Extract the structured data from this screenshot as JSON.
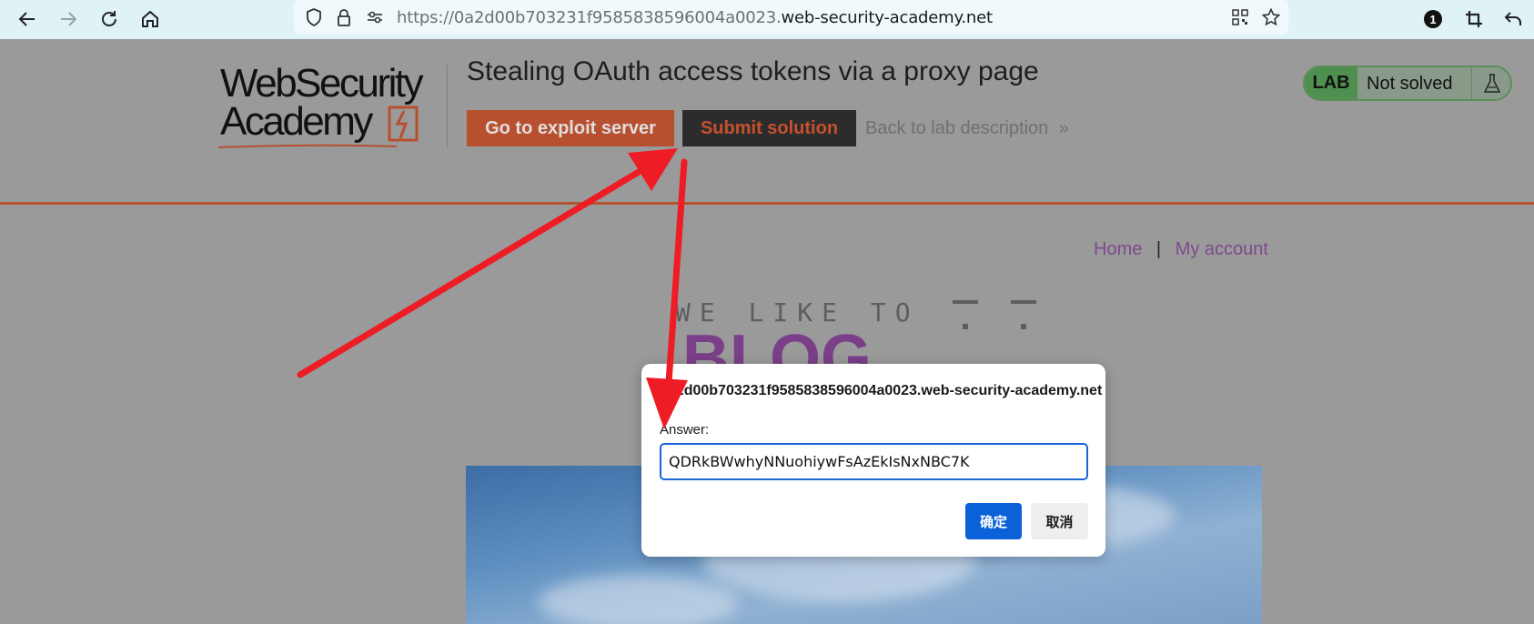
{
  "browser": {
    "url_prefix": "https://0a2d00b703231f9585838596004a0023.",
    "url_domain": "web-security-academy.net",
    "extension_badge": "1"
  },
  "header": {
    "logo_line1": "WebSecurity",
    "logo_line2": "Academy",
    "lab_title": "Stealing OAuth access tokens via a proxy page",
    "exploit_button": "Go to exploit server",
    "submit_button": "Submit solution",
    "back_link": "Back to lab description",
    "back_link_glyph": "»",
    "lab_badge": "LAB",
    "lab_status": "Not solved"
  },
  "nav": {
    "home": "Home",
    "separator": "|",
    "my_account": "My account"
  },
  "blog": {
    "tagline": "WE LIKE TO",
    "big_word": "BLOG"
  },
  "dialog": {
    "origin": "0a2d00b703231f9585838596004a0023.web-security-academy.net",
    "answer_label": "Answer:",
    "answer_value": "QDRkBWwhyNNuohiywFsAzEkIsNxNBC7K",
    "ok_label": "确定",
    "cancel_label": "取消"
  },
  "colors": {
    "exploit_button": "#b85030",
    "submit_button": "#2c2c2c",
    "ok_button": "#0a61d8",
    "arrow": "#ee1c24"
  }
}
